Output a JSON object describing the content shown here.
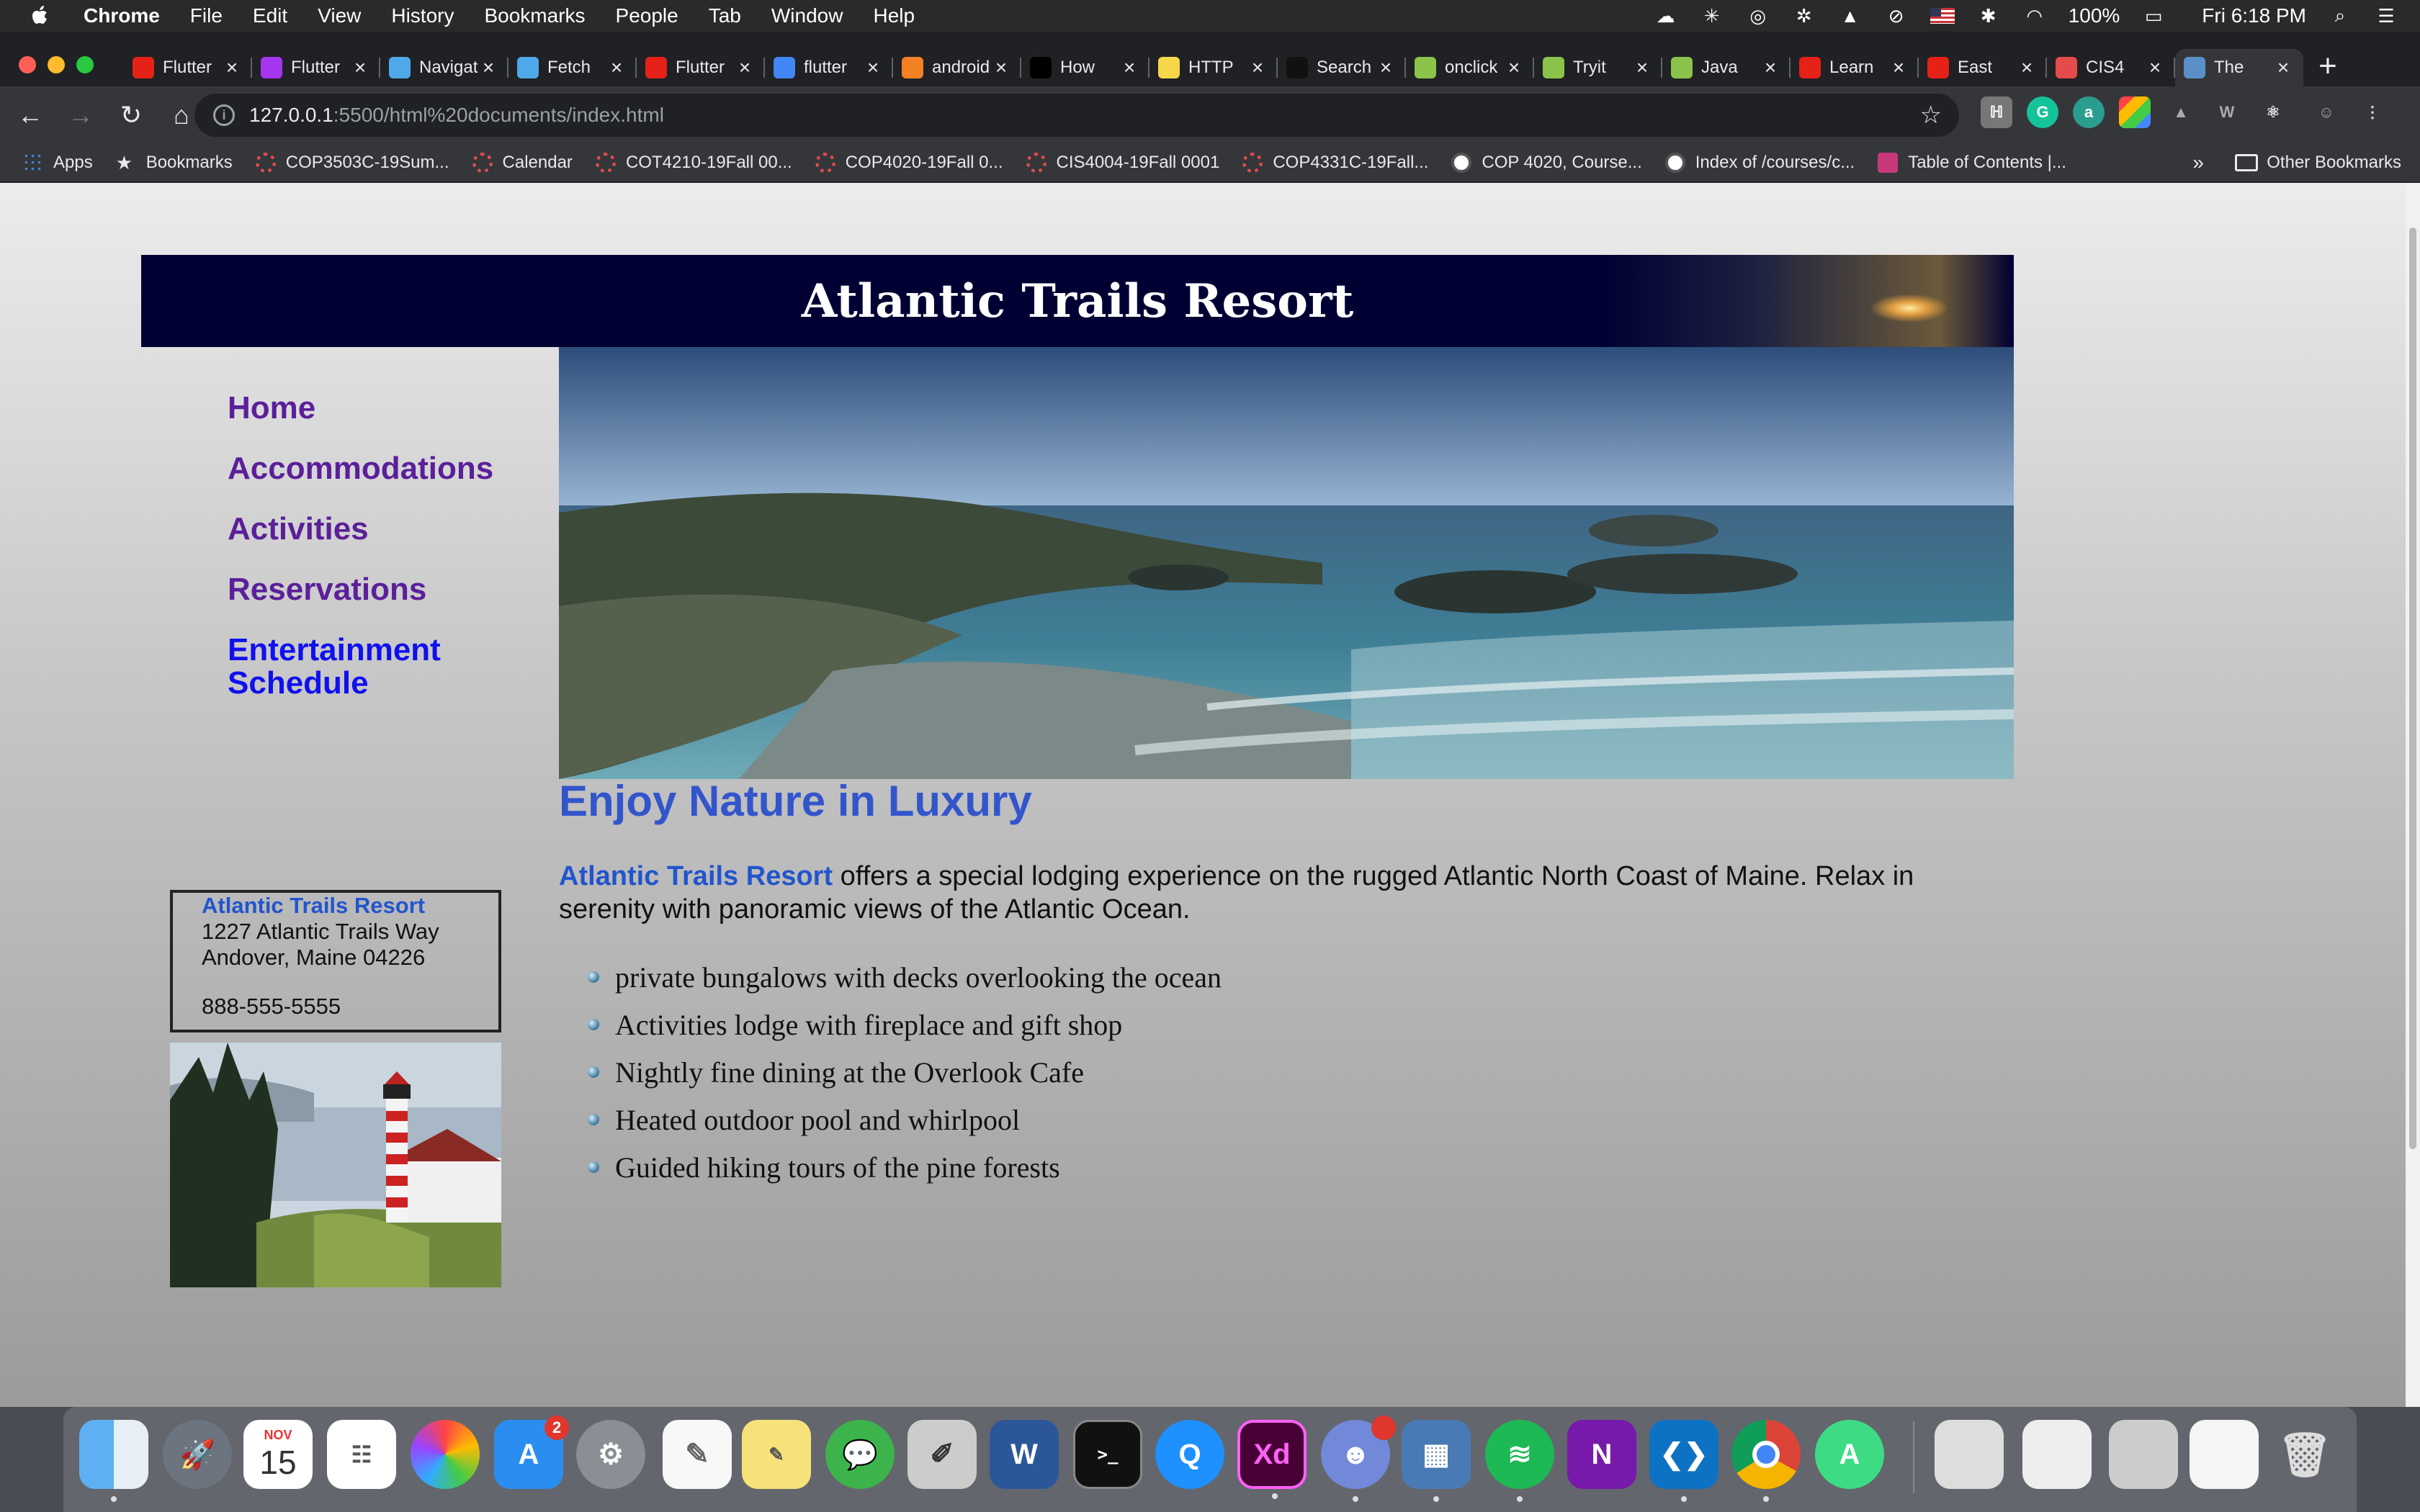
{
  "menubar": {
    "app_name": "Chrome",
    "items": [
      "File",
      "Edit",
      "View",
      "History",
      "Bookmarks",
      "People",
      "Tab",
      "Window",
      "Help"
    ],
    "battery": "100%",
    "clock": "Fri 6:18 PM"
  },
  "browser": {
    "tabs": [
      {
        "label": "Flutter",
        "icon": "youtube-icon",
        "color": "#e62117"
      },
      {
        "label": "Flutter",
        "icon": "udemy-icon",
        "color": "#a435f0"
      },
      {
        "label": "Navigation",
        "icon": "flutter-icon",
        "color": "#4fa8e8"
      },
      {
        "label": "Fetch",
        "icon": "flutter-icon",
        "color": "#4fa8e8"
      },
      {
        "label": "Flutter",
        "icon": "youtube-icon",
        "color": "#e62117"
      },
      {
        "label": "flutter",
        "icon": "google-icon",
        "color": "#4285f4"
      },
      {
        "label": "android",
        "icon": "stackoverflow-icon",
        "color": "#f48024"
      },
      {
        "label": "How",
        "icon": "medium-icon",
        "color": "#000000"
      },
      {
        "label": "HTTP",
        "icon": "python-icon",
        "color": "#f7d74a"
      },
      {
        "label": "Search",
        "icon": "github-icon",
        "color": "#111111"
      },
      {
        "label": "onclick",
        "icon": "w3schools-icon",
        "color": "#8bc34a"
      },
      {
        "label": "Tryit",
        "icon": "w3schools-icon",
        "color": "#8bc34a"
      },
      {
        "label": "Java",
        "icon": "w3schools-icon",
        "color": "#8bc34a"
      },
      {
        "label": "Learn",
        "icon": "youtube-icon",
        "color": "#e62117"
      },
      {
        "label": "East",
        "icon": "youtube-icon",
        "color": "#e62117"
      },
      {
        "label": "CIS4",
        "icon": "canvas-icon",
        "color": "#e54b4b"
      },
      {
        "label": "The",
        "icon": "page-icon",
        "color": "#5b8fc7"
      }
    ],
    "url_host": "127.0.0.1",
    "url_rest": ":5500/html%20documents/index.html",
    "bookmarks": [
      {
        "label": "Apps",
        "icon": "grid"
      },
      {
        "label": "Bookmarks",
        "icon": "star"
      },
      {
        "label": "COP3503C-19Sum...",
        "icon": "cog"
      },
      {
        "label": "Calendar",
        "icon": "cog"
      },
      {
        "label": "COT4210-19Fall 00...",
        "icon": "cog"
      },
      {
        "label": "COP4020-19Fall 0...",
        "icon": "cog"
      },
      {
        "label": "CIS4004-19Fall 0001",
        "icon": "cog"
      },
      {
        "label": "COP4331C-19Fall...",
        "icon": "cog"
      },
      {
        "label": "COP 4020, Course...",
        "icon": "globe"
      },
      {
        "label": "Index of /courses/c...",
        "icon": "globe"
      },
      {
        "label": "Table of Contents |...",
        "icon": "book"
      }
    ],
    "bookmarks_more": "»",
    "other_bookmarks": "Other Bookmarks"
  },
  "site": {
    "title": "Atlantic Trails Resort",
    "nav": [
      "Home",
      "Accommodations",
      "Activities",
      "Reservations",
      "Entertainment Schedule"
    ],
    "heading": "Enjoy Nature in Luxury",
    "intro_brand": "Atlantic Trails Resort",
    "intro_text": " offers a special lodging experience on the rugged Atlantic North Coast of Maine. Relax in serenity with panoramic views of the Atlantic Ocean.",
    "features": [
      "private bungalows with decks overlooking the ocean",
      "Activities lodge with fireplace and gift shop",
      "Nightly fine dining at the Overlook Cafe",
      "Heated outdoor pool and whirlpool",
      "Guided hiking tours of the pine forests"
    ],
    "address": {
      "name": "Atlantic Trails Resort",
      "street": "1227 Atlantic Trails Way",
      "city": "Andover, Maine 04226",
      "phone": "888-555-5555"
    }
  },
  "dock": {
    "calendar_month": "NOV",
    "calendar_day": "15",
    "app_store_badge": "2",
    "xd_label": "Xd",
    "word_label": "W",
    "onenote_label": "N",
    "terminal_label": ">_"
  }
}
